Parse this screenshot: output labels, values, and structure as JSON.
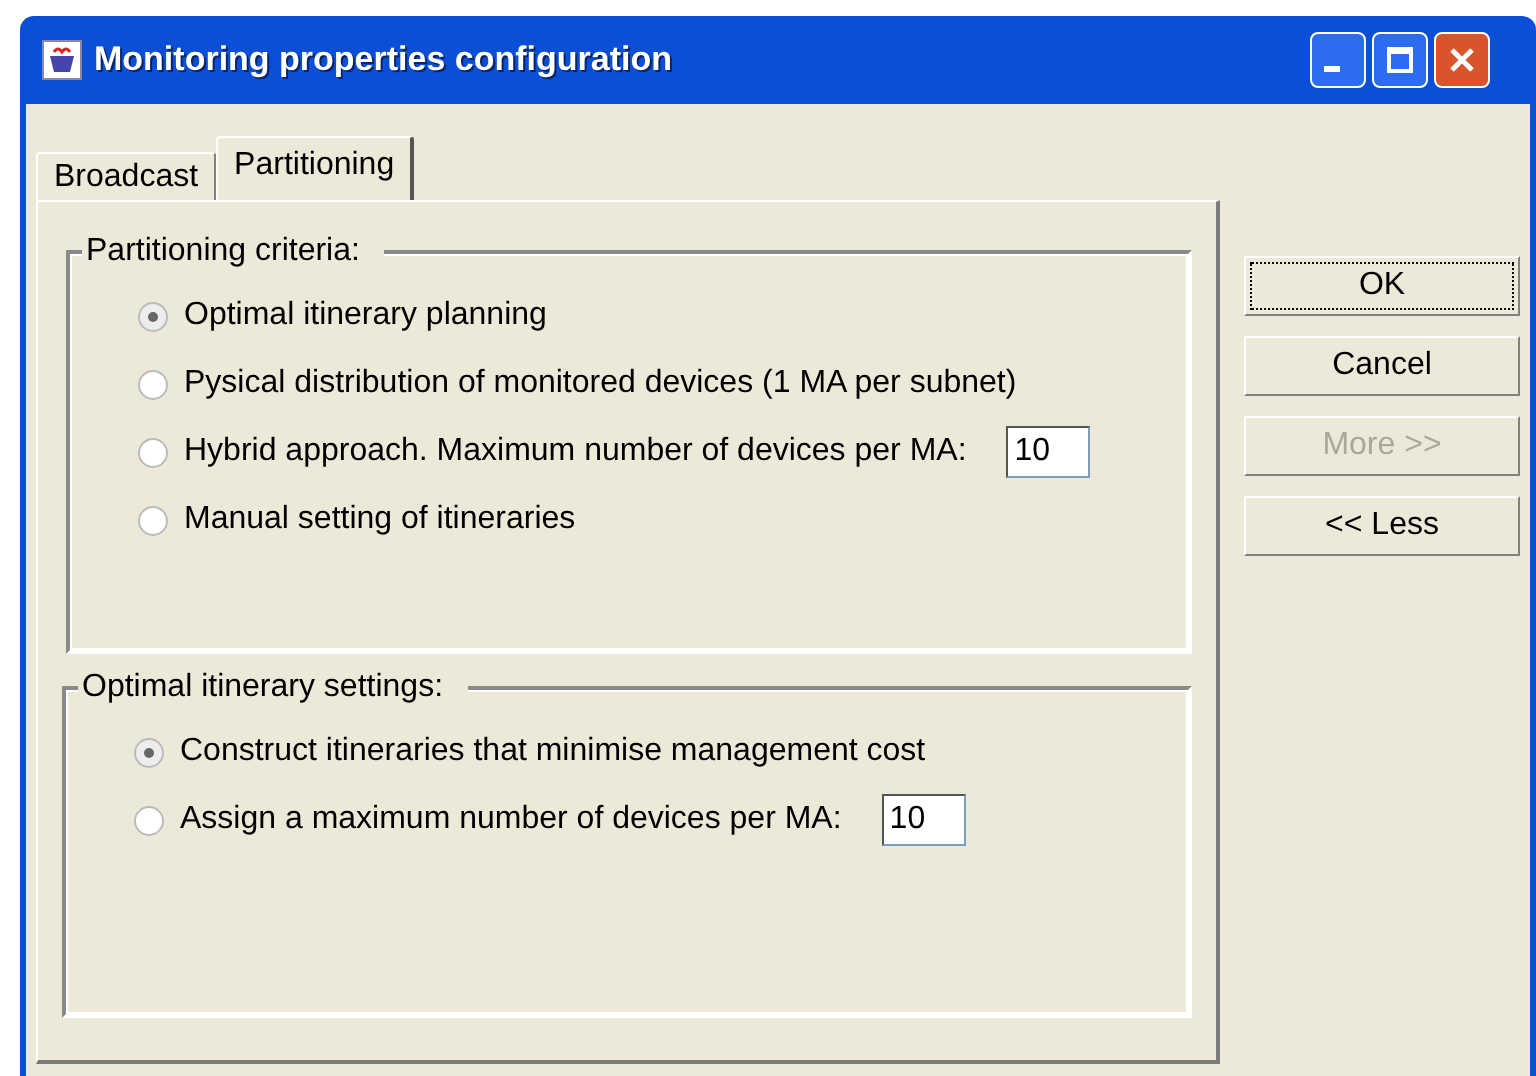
{
  "window": {
    "title": "Monitoring properties configuration"
  },
  "tabs": [
    {
      "label": "Broadcast",
      "selected": false
    },
    {
      "label": "Partitioning",
      "selected": true
    }
  ],
  "groups": [
    {
      "title": "Partitioning criteria:",
      "options": [
        {
          "label": "Optimal itinerary planning",
          "selected": true
        },
        {
          "label": "Pysical distribution of monitored devices (1 MA per subnet)",
          "selected": false
        },
        {
          "label": "Hybrid approach. Maximum number of devices per MA:",
          "selected": false,
          "field_value": "10"
        },
        {
          "label": "Manual setting of itineraries",
          "selected": false
        }
      ]
    },
    {
      "title": "Optimal itinerary settings:",
      "options": [
        {
          "label": "Construct itineraries that minimise management cost",
          "selected": true
        },
        {
          "label": "Assign a maximum number of devices per MA:",
          "selected": false,
          "field_value": "10"
        }
      ]
    }
  ],
  "buttons": [
    {
      "label": "OK",
      "focused": true,
      "disabled": false
    },
    {
      "label": "Cancel",
      "focused": false,
      "disabled": false
    },
    {
      "label": "More >>",
      "focused": false,
      "disabled": true
    },
    {
      "label": "<< Less",
      "focused": false,
      "disabled": false
    }
  ]
}
